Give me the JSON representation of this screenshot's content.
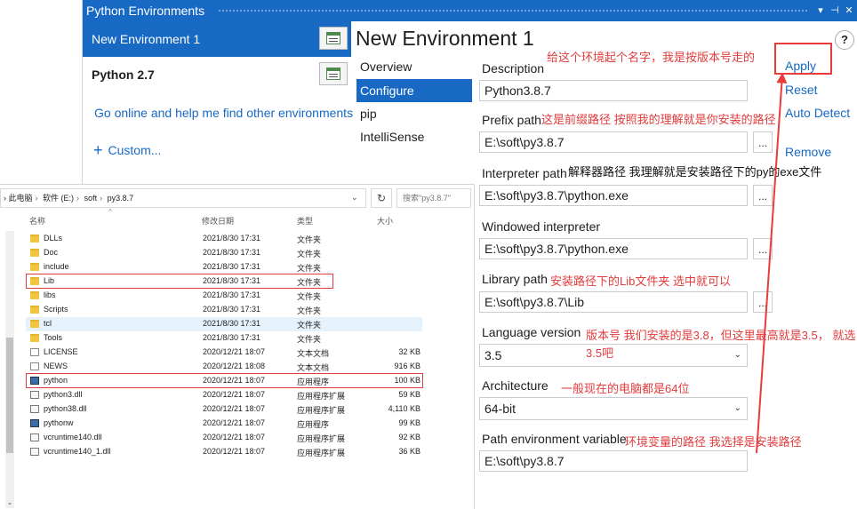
{
  "window": {
    "title": "Python Environments",
    "ctl_pin": "▾",
    "ctl_dock": "⊣",
    "ctl_close": "✕"
  },
  "env_list": {
    "items": [
      {
        "label": "New Environment 1",
        "selected": true
      },
      {
        "label": "Python 2.7",
        "selected": false
      }
    ],
    "go_online": "Go online and help me find other environments",
    "custom_plus": "+",
    "custom": "Custom..."
  },
  "env_header": "New Environment 1",
  "tabs": [
    {
      "label": "Overview"
    },
    {
      "label": "Configure",
      "active": true
    },
    {
      "label": "pip"
    },
    {
      "label": "IntelliSense"
    }
  ],
  "form": {
    "description": {
      "label": "Description",
      "value": "Python3.8.7"
    },
    "prefix_path": {
      "label": "Prefix path",
      "value": "E:\\soft\\py3.8.7"
    },
    "interpreter_path": {
      "label": "Interpreter path",
      "value": "E:\\soft\\py3.8.7\\python.exe"
    },
    "windowed_interpreter": {
      "label": "Windowed interpreter",
      "value": "E:\\soft\\py3.8.7\\python.exe"
    },
    "library_path": {
      "label": "Library path",
      "value": "E:\\soft\\py3.8.7\\Lib"
    },
    "language_version": {
      "label": "Language version",
      "value": "3.5"
    },
    "architecture": {
      "label": "Architecture",
      "value": "64-bit"
    },
    "path_env_var": {
      "label": "Path environment variable",
      "value": "E:\\soft\\py3.8.7"
    },
    "browse_label": "...",
    "select_chevron": "⌄"
  },
  "actions": {
    "apply": "Apply",
    "reset": "Reset",
    "auto_detect": "Auto Detect",
    "remove": "Remove",
    "help": "?"
  },
  "annotations": {
    "description": "给这个环境起个名字，我是按版本号走的",
    "prefix": "这是前缀路径 按照我的理解就是你安装的路径",
    "interpreter": "解释器路径 我理解就是安装路径下的py的exe文件",
    "library": "安装路径下的Lib文件夹 选中就可以",
    "version_line1": "版本号 我们安装的是3.8，但这里最高就是3.5， 就选",
    "version_line2": "3.5吧",
    "architecture": "一般现在的电脑都是64位",
    "path_env": "环境变量的路径  我选择是安装路径"
  },
  "colors": {
    "accent": "#1769c4",
    "annotation_red": "#e23b3b"
  },
  "explorer": {
    "breadcrumb": [
      "此电脑",
      "软件 (E:)",
      "soft",
      "py3.8.7"
    ],
    "breadcrumb_sep": "›",
    "breadcrumb_lead": "›",
    "dropdown": "⌄",
    "refresh": "↻",
    "search_placeholder": "搜索\"py3.8.7\"",
    "sort_caret": "^",
    "scroll_down": "⌄",
    "columns": {
      "name": "名称",
      "date": "修改日期",
      "type": "类型",
      "size": "大小"
    },
    "rows": [
      {
        "name": "DLLs",
        "date": "2021/8/30 17:31",
        "type": "文件夹",
        "size": "",
        "icon": "folder"
      },
      {
        "name": "Doc",
        "date": "2021/8/30 17:31",
        "type": "文件夹",
        "size": "",
        "icon": "folder"
      },
      {
        "name": "include",
        "date": "2021/8/30 17:31",
        "type": "文件夹",
        "size": "",
        "icon": "folder"
      },
      {
        "name": "Lib",
        "date": "2021/8/30 17:31",
        "type": "文件夹",
        "size": "",
        "icon": "folder",
        "highlight": true
      },
      {
        "name": "libs",
        "date": "2021/8/30 17:31",
        "type": "文件夹",
        "size": "",
        "icon": "folder"
      },
      {
        "name": "Scripts",
        "date": "2021/8/30 17:31",
        "type": "文件夹",
        "size": "",
        "icon": "folder"
      },
      {
        "name": "tcl",
        "date": "2021/8/30 17:31",
        "type": "文件夹",
        "size": "",
        "icon": "folder",
        "selected": true
      },
      {
        "name": "Tools",
        "date": "2021/8/30 17:31",
        "type": "文件夹",
        "size": "",
        "icon": "folder"
      },
      {
        "name": "LICENSE",
        "date": "2020/12/21 18:07",
        "type": "文本文档",
        "size": "32 KB",
        "icon": "file"
      },
      {
        "name": "NEWS",
        "date": "2020/12/21 18:08",
        "type": "文本文档",
        "size": "916 KB",
        "icon": "file"
      },
      {
        "name": "python",
        "date": "2020/12/21 18:07",
        "type": "应用程序",
        "size": "100 KB",
        "icon": "exe",
        "highlight": true
      },
      {
        "name": "python3.dll",
        "date": "2020/12/21 18:07",
        "type": "应用程序扩展",
        "size": "59 KB",
        "icon": "dll"
      },
      {
        "name": "python38.dll",
        "date": "2020/12/21 18:07",
        "type": "应用程序扩展",
        "size": "4,110 KB",
        "icon": "dll"
      },
      {
        "name": "pythonw",
        "date": "2020/12/21 18:07",
        "type": "应用程序",
        "size": "99 KB",
        "icon": "exe"
      },
      {
        "name": "vcruntime140.dll",
        "date": "2020/12/21 18:07",
        "type": "应用程序扩展",
        "size": "92 KB",
        "icon": "dll"
      },
      {
        "name": "vcruntime140_1.dll",
        "date": "2020/12/21 18:07",
        "type": "应用程序扩展",
        "size": "36 KB",
        "icon": "dll"
      }
    ]
  }
}
